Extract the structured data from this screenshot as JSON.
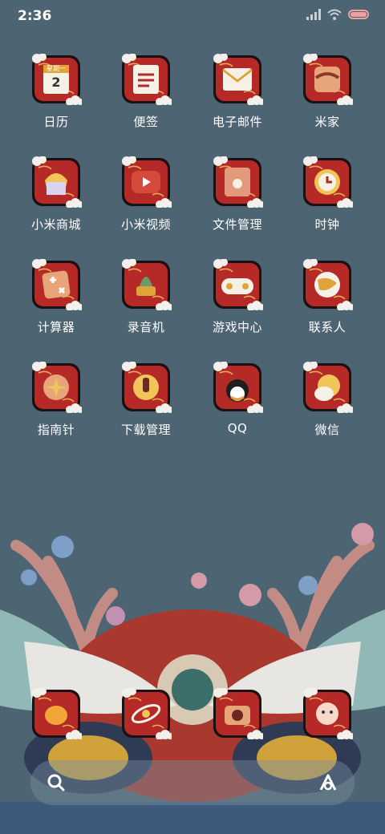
{
  "status_bar": {
    "time": "2:36",
    "icons": [
      "signal-icon",
      "wifi-icon",
      "battery-icon"
    ]
  },
  "apps": [
    {
      "label": "日历",
      "icon": "calendar-icon",
      "badge_text": "星期一",
      "date_text": "2"
    },
    {
      "label": "便签",
      "icon": "notes-icon"
    },
    {
      "label": "电子邮件",
      "icon": "email-icon"
    },
    {
      "label": "米家",
      "icon": "mi-home-icon"
    },
    {
      "label": "小米商城",
      "icon": "mi-store-icon"
    },
    {
      "label": "小米视频",
      "icon": "mi-video-icon"
    },
    {
      "label": "文件管理",
      "icon": "file-manager-icon"
    },
    {
      "label": "时钟",
      "icon": "clock-icon"
    },
    {
      "label": "计算器",
      "icon": "calculator-icon"
    },
    {
      "label": "录音机",
      "icon": "recorder-icon"
    },
    {
      "label": "游戏中心",
      "icon": "game-center-icon"
    },
    {
      "label": "联系人",
      "icon": "contacts-icon"
    },
    {
      "label": "指南针",
      "icon": "compass-icon"
    },
    {
      "label": "下载管理",
      "icon": "download-manager-icon"
    },
    {
      "label": "QQ",
      "icon": "qq-icon"
    },
    {
      "label": "微信",
      "icon": "wechat-icon"
    }
  ],
  "dock": [
    {
      "icon": "phone-icon"
    },
    {
      "icon": "browser-icon"
    },
    {
      "icon": "camera-icon"
    },
    {
      "icon": "messages-icon"
    }
  ],
  "search_bar": {
    "left_icon": "search-icon",
    "right_icon": "assistant-icon"
  },
  "colors": {
    "background": "#4d6472",
    "tile_red": "#b52a26",
    "tile_outline": "#1a1112",
    "cloud": "#f3f0ea",
    "label_text": "#ffffff"
  }
}
